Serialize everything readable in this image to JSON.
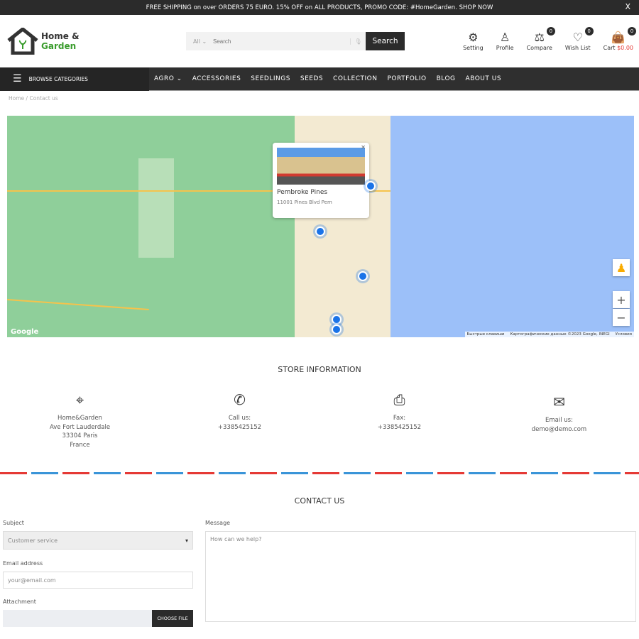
{
  "topbar": {
    "text": "FREE SHIPPING on over ORDERS 75 EURO. 15% OFF on ALL PRODUCTS, PROMO CODE: #HomeGarden. SHOP NOW",
    "close": "X"
  },
  "logo": {
    "line1": "Home &",
    "line2": "Garden"
  },
  "search": {
    "category": "All",
    "placeholder": "Search",
    "button": "Search"
  },
  "header_icons": [
    {
      "label": "Setting",
      "icon": "gear-icon"
    },
    {
      "label": "Profile",
      "icon": "user-icon"
    },
    {
      "label": "Compare",
      "icon": "scale-icon",
      "count": "0"
    },
    {
      "label": "Wish List",
      "icon": "heart-icon",
      "count": "0"
    },
    {
      "label": "Cart",
      "icon": "bag-icon",
      "count": "0",
      "amount": "$0.00"
    }
  ],
  "nav": {
    "browse": "BROWSE CATEGORIES",
    "items": [
      "AGRO",
      "ACCESSORIES",
      "SEEDLINGS",
      "SEEDS",
      "COLLECTION",
      "PORTFOLIO",
      "BLOG",
      "ABOUT US"
    ]
  },
  "breadcrumb": [
    "Home",
    "Contact us"
  ],
  "map": {
    "popup_title": "Pembroke Pines",
    "popup_address": "11001 Pines Blvd Pem",
    "google": "Google",
    "attribution": [
      "Быстрые клавиши",
      "Картографические данные ©2023 Google, INEGI",
      "Условия"
    ]
  },
  "store": {
    "title": "STORE INFORMATION",
    "address": [
      "Home&Garden",
      "Ave Fort Lauderdale",
      "33304 Paris",
      "France"
    ],
    "call_label": "Call us:",
    "call": "+3385425152",
    "fax_label": "Fax:",
    "fax": "+3385425152",
    "email_label": "Email us:",
    "email": "demo@demo.com"
  },
  "contact": {
    "title": "CONTACT US",
    "subject_label": "Subject",
    "subject_value": "Customer service",
    "email_label": "Email address",
    "email_placeholder": "your@email.com",
    "attachment_label": "Attachment",
    "choose_file": "CHOOSE FILE",
    "message_label": "Message",
    "message_placeholder": "How can we help?"
  },
  "colors": {
    "dark": "#2b2b2b",
    "green": "#3a9c2d",
    "price": "#e53935"
  }
}
